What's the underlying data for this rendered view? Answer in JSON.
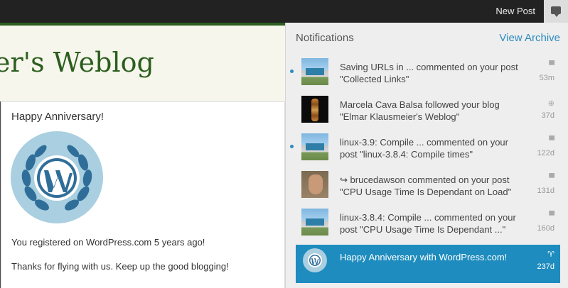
{
  "topbar": {
    "new_post": "New Post",
    "notifications_icon": "speech-bubble-icon"
  },
  "blog": {
    "title": "er's Weblog",
    "card": {
      "title": "Happy Anniversary!",
      "line1": "You registered on WordPress.com 5 years ago!",
      "line2": "Thanks for flying with us. Keep up the good blogging!"
    }
  },
  "panel": {
    "title": "Notifications",
    "archive_link": "View Archive",
    "items": [
      {
        "unread": true,
        "thumb": "bus-photo",
        "line1": "Saving URLs in ... commented on your post",
        "line2": "\"Collected Links\"",
        "icon": "comment-icon",
        "time": "53m"
      },
      {
        "unread": false,
        "thumb": "totem-photo",
        "line1": "Marcela Cava Balsa followed your blog",
        "line2": "\"Elmar Klausmeier's Weblog\"",
        "icon": "follow-icon",
        "time": "37d"
      },
      {
        "unread": true,
        "thumb": "bus-photo",
        "line1": "linux-3.9: Compile ... commented on your",
        "line2": "post \"linux-3.8.4: Compile times\"",
        "icon": "comment-icon",
        "time": "122d"
      },
      {
        "unread": false,
        "thumb": "avatar-photo",
        "line1": "↪ brucedawson commented on your post",
        "line2": "\"CPU Usage Time Is Dependant on Load\"",
        "icon": "comment-icon",
        "time": "131d"
      },
      {
        "unread": false,
        "thumb": "bus-photo",
        "line1": "linux-3.8.4: Compile ... commented on your",
        "line2": "post \"CPU Usage Time Is Dependant ...\"",
        "icon": "comment-icon",
        "time": "160d"
      },
      {
        "unread": false,
        "active": true,
        "thumb": "wordpress-badge",
        "line1": "Happy Anniversary with WordPress.com!",
        "line2": "",
        "icon": "trophy-icon",
        "time": "237d"
      }
    ]
  },
  "colors": {
    "accent": "#1e8cbe",
    "blog_green": "#2b5e1e",
    "topbar": "#222222"
  }
}
